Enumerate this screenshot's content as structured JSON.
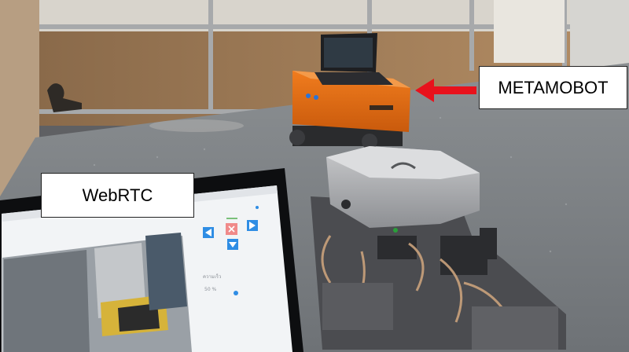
{
  "labels": {
    "robot": "METAMOBOT",
    "laptop": "WebRTC"
  },
  "screen_ui": {
    "field_label": "ความเร็ว",
    "speed_value": "50 %"
  },
  "icons": [
    "arrow-left-icon",
    "stop-x-icon",
    "arrow-up-icon",
    "arrow-right-icon",
    "arrow-down-icon",
    "slider-knob-icon"
  ],
  "colors": {
    "arrow": "#e8121c",
    "robot_body": "#e26a12",
    "control_blue": "#2f8de4",
    "stop_red": "#f08a8a"
  }
}
